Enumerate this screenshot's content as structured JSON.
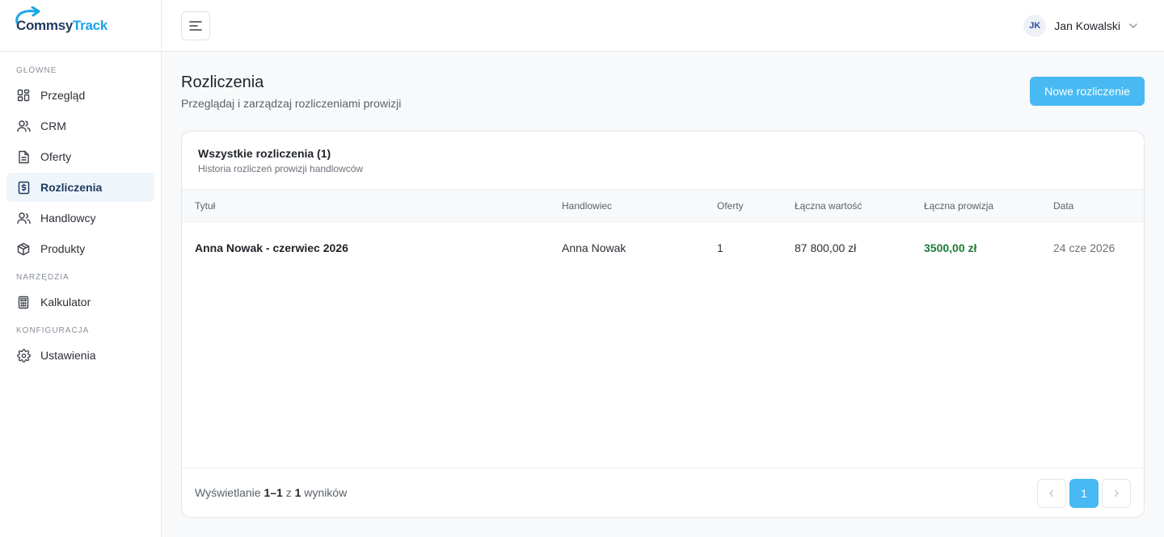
{
  "brand": {
    "name_part1": "Commsy",
    "name_part2": "Track"
  },
  "sidebar": {
    "sections": [
      {
        "label": "GŁÓWNE",
        "items": [
          {
            "label": "Przegląd",
            "icon": "dashboard-icon"
          },
          {
            "label": "CRM",
            "icon": "users-icon"
          },
          {
            "label": "Oferty",
            "icon": "document-icon"
          },
          {
            "label": "Rozliczenia",
            "icon": "dollar-document-icon",
            "active": true
          },
          {
            "label": "Handlowcy",
            "icon": "user-group-icon"
          },
          {
            "label": "Produkty",
            "icon": "box-icon"
          }
        ]
      },
      {
        "label": "NARZĘDZIA",
        "items": [
          {
            "label": "Kalkulator",
            "icon": "calculator-icon"
          }
        ]
      },
      {
        "label": "KONFIGURACJA",
        "items": [
          {
            "label": "Ustawienia",
            "icon": "gear-icon"
          }
        ]
      }
    ]
  },
  "topbar": {
    "user_initials": "JK",
    "user_name": "Jan Kowalski"
  },
  "page": {
    "title": "Rozliczenia",
    "subtitle": "Przeglądaj i zarządzaj rozliczeniami prowizji",
    "new_button": "Nowe rozliczenie"
  },
  "card": {
    "title": "Wszystkie rozliczenia (1)",
    "subtitle": "Historia rozliczeń prowizji handlowców",
    "columns": {
      "title": "Tytuł",
      "salesperson": "Handlowiec",
      "offers": "Oferty",
      "total_value": "Łączna wartość",
      "total_commission": "Łączna prowizja",
      "date": "Data"
    },
    "rows": [
      {
        "title": "Anna Nowak - czerwiec 2026",
        "salesperson": "Anna Nowak",
        "offers": "1",
        "total_value": "87 800,00 zł",
        "total_commission": "3500,00 zł",
        "date": "24 cze 2026"
      }
    ],
    "footer": {
      "prefix": "Wyświetlanie",
      "range": "1–1",
      "of": "z",
      "total": "1",
      "suffix": "wyników",
      "current_page": "1"
    }
  },
  "colors": {
    "accent": "#48b9f2",
    "brand_dark": "#1e3a5f",
    "commission_green": "#1e7b34"
  }
}
